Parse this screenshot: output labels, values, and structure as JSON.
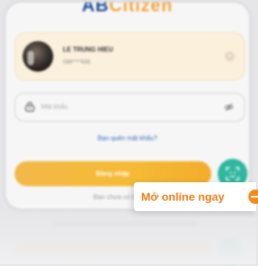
{
  "app": {
    "logo_prefix": "AB",
    "logo_suffix": "Citizen"
  },
  "account": {
    "name": "LE TRUNG HIEU",
    "phone": "098****836"
  },
  "password": {
    "placeholder": "Mật khẩu"
  },
  "links": {
    "forgot": "Bạn quên mật khẩu?",
    "signup": "Bạn chưa có tài khoản?"
  },
  "buttons": {
    "login": "Đăng nhập"
  },
  "cta": {
    "label": "Mở online ngay"
  },
  "colors": {
    "brand_blue": "#1e4c93",
    "brand_orange": "#f4a53d",
    "login_button": "#f5ba35",
    "face_id_button": "#2fb79f",
    "cta_text": "#f07c13"
  }
}
